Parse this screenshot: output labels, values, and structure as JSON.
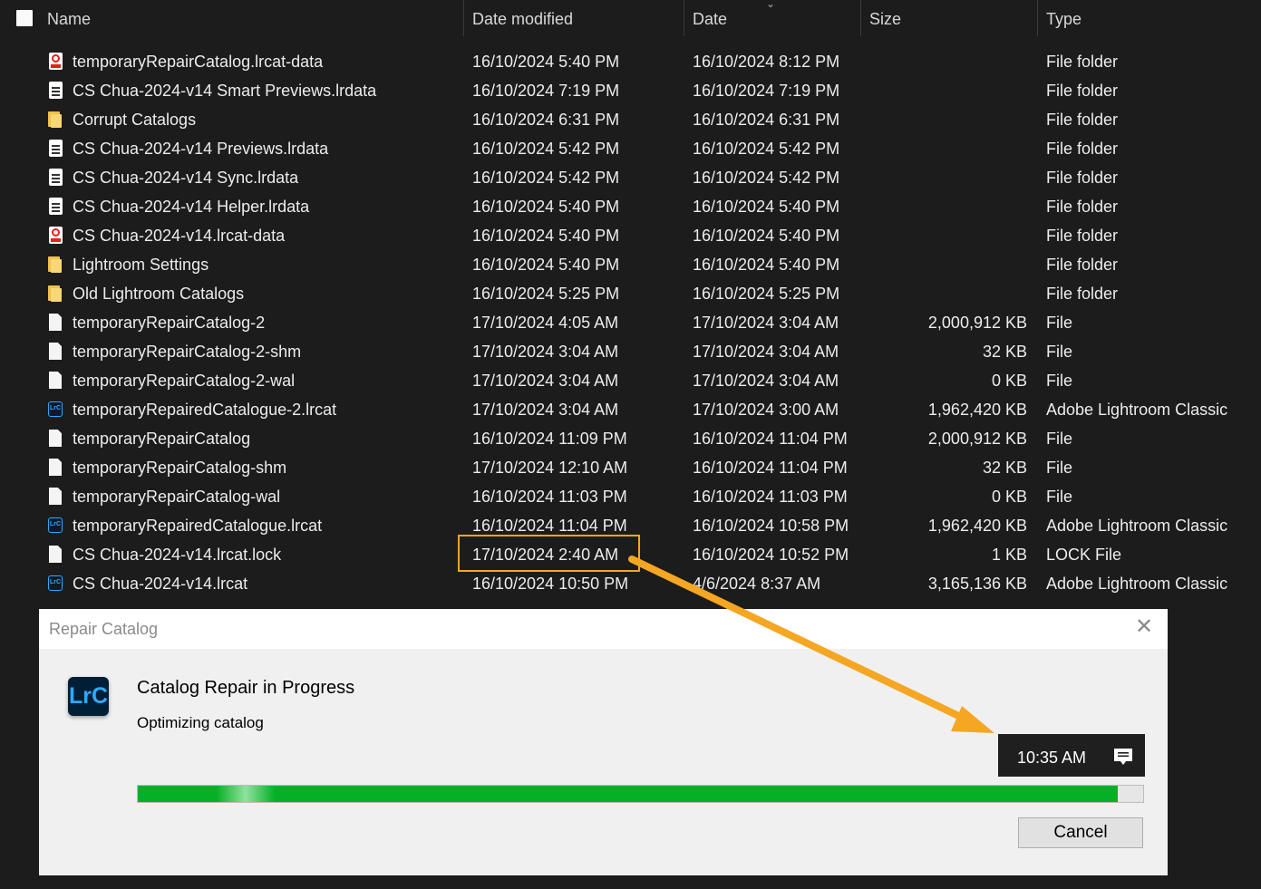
{
  "header": {
    "name": "Name",
    "date_modified": "Date modified",
    "date": "Date",
    "size": "Size",
    "type": "Type"
  },
  "files": [
    {
      "icon": "data-file-icon",
      "name": "temporaryRepairCatalog.lrcat-data",
      "modified": "16/10/2024 5:40 PM",
      "date": "16/10/2024 8:12 PM",
      "size": "",
      "type": "File folder"
    },
    {
      "icon": "lrdata-file-icon",
      "name": "CS Chua-2024-v14 Smart Previews.lrdata",
      "modified": "16/10/2024 7:19 PM",
      "date": "16/10/2024 7:19 PM",
      "size": "",
      "type": "File folder"
    },
    {
      "icon": "folder-icon",
      "name": "Corrupt Catalogs",
      "modified": "16/10/2024 6:31 PM",
      "date": "16/10/2024 6:31 PM",
      "size": "",
      "type": "File folder"
    },
    {
      "icon": "lrdata-file-icon",
      "name": "CS Chua-2024-v14 Previews.lrdata",
      "modified": "16/10/2024 5:42 PM",
      "date": "16/10/2024 5:42 PM",
      "size": "",
      "type": "File folder"
    },
    {
      "icon": "lrdata-file-icon",
      "name": "CS Chua-2024-v14 Sync.lrdata",
      "modified": "16/10/2024 5:42 PM",
      "date": "16/10/2024 5:42 PM",
      "size": "",
      "type": "File folder"
    },
    {
      "icon": "lrdata-file-icon",
      "name": "CS Chua-2024-v14 Helper.lrdata",
      "modified": "16/10/2024 5:40 PM",
      "date": "16/10/2024 5:40 PM",
      "size": "",
      "type": "File folder"
    },
    {
      "icon": "data-file-icon",
      "name": "CS Chua-2024-v14.lrcat-data",
      "modified": "16/10/2024 5:40 PM",
      "date": "16/10/2024 5:40 PM",
      "size": "",
      "type": "File folder"
    },
    {
      "icon": "folder-icon",
      "name": "Lightroom Settings",
      "modified": "16/10/2024 5:40 PM",
      "date": "16/10/2024 5:40 PM",
      "size": "",
      "type": "File folder"
    },
    {
      "icon": "folder-icon",
      "name": "Old Lightroom Catalogs",
      "modified": "16/10/2024 5:25 PM",
      "date": "16/10/2024 5:25 PM",
      "size": "",
      "type": "File folder"
    },
    {
      "icon": "file-icon",
      "name": "temporaryRepairCatalog-2",
      "modified": "17/10/2024 4:05 AM",
      "date": "17/10/2024 3:04 AM",
      "size": "2,000,912 KB",
      "type": "File"
    },
    {
      "icon": "file-icon",
      "name": "temporaryRepairCatalog-2-shm",
      "modified": "17/10/2024 3:04 AM",
      "date": "17/10/2024 3:04 AM",
      "size": "32 KB",
      "type": "File"
    },
    {
      "icon": "file-icon",
      "name": "temporaryRepairCatalog-2-wal",
      "modified": "17/10/2024 3:04 AM",
      "date": "17/10/2024 3:04 AM",
      "size": "0 KB",
      "type": "File"
    },
    {
      "icon": "lrc-file-icon",
      "name": "temporaryRepairedCatalogue-2.lrcat",
      "modified": "17/10/2024 3:04 AM",
      "date": "17/10/2024 3:00 AM",
      "size": "1,962,420 KB",
      "type": "Adobe Lightroom Classic"
    },
    {
      "icon": "file-icon",
      "name": "temporaryRepairCatalog",
      "modified": "16/10/2024 11:09 PM",
      "date": "16/10/2024 11:04 PM",
      "size": "2,000,912 KB",
      "type": "File"
    },
    {
      "icon": "file-icon",
      "name": "temporaryRepairCatalog-shm",
      "modified": "17/10/2024 12:10 AM",
      "date": "16/10/2024 11:04 PM",
      "size": "32 KB",
      "type": "File"
    },
    {
      "icon": "file-icon",
      "name": "temporaryRepairCatalog-wal",
      "modified": "16/10/2024 11:03 PM",
      "date": "16/10/2024 11:03 PM",
      "size": "0 KB",
      "type": "File"
    },
    {
      "icon": "lrc-file-icon",
      "name": "temporaryRepairedCatalogue.lrcat",
      "modified": "16/10/2024 11:04 PM",
      "date": "16/10/2024 10:58 PM",
      "size": "1,962,420 KB",
      "type": "Adobe Lightroom Classic"
    },
    {
      "icon": "file-icon",
      "name": "CS Chua-2024-v14.lrcat.lock",
      "modified": "17/10/2024 2:40 AM",
      "date": "16/10/2024 10:52 PM",
      "size": "1 KB",
      "type": "LOCK File"
    },
    {
      "icon": "lrc-file-icon",
      "name": "CS Chua-2024-v14.lrcat",
      "modified": "16/10/2024 10:50 PM",
      "date": "4/6/2024 8:37 AM",
      "size": "3,165,136 KB",
      "type": "Adobe Lightroom Classic"
    }
  ],
  "dialog": {
    "title": "Repair Catalog",
    "app_icon_text": "LrC",
    "heading": "Catalog Repair in Progress",
    "status": "Optimizing catalog",
    "progress": 0.975,
    "cancel_label": "Cancel"
  },
  "taskbar_clock": {
    "time": "10:35 AM",
    "icon": "notification-icon"
  },
  "colors": {
    "annotation": "#f5a623",
    "progress": "#06b025",
    "lrc_blue": "#31a8ff"
  }
}
